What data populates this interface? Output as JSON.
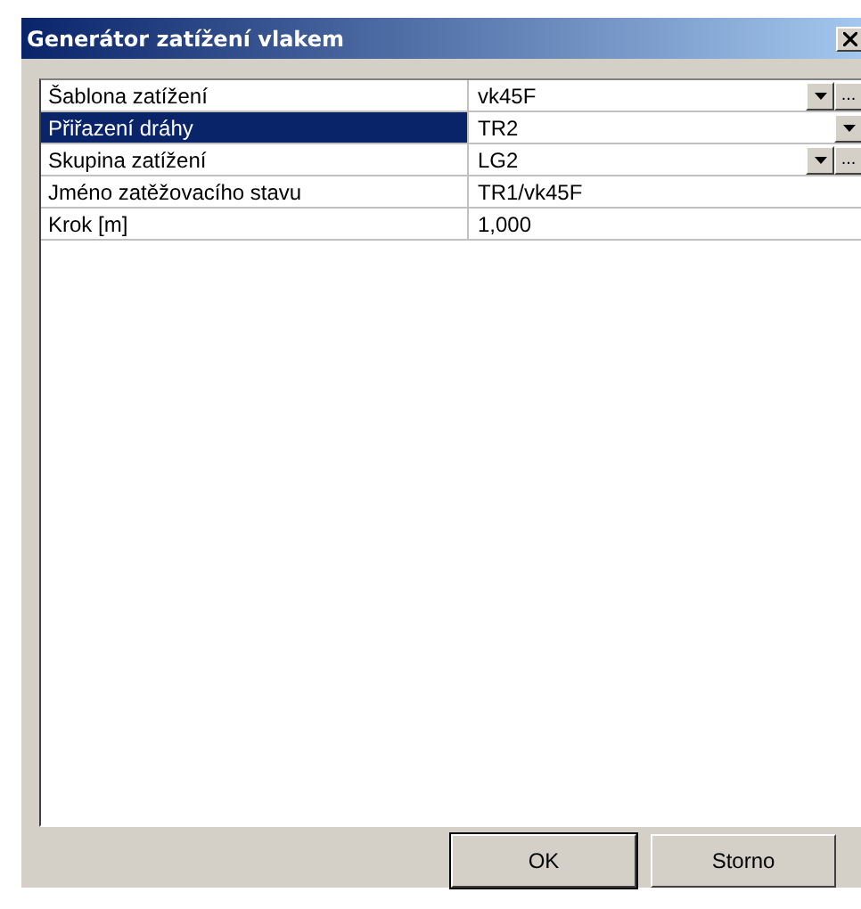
{
  "window": {
    "title": "Generátor zatížení vlakem"
  },
  "rows": [
    {
      "label": "Šablona zatížení",
      "value": "vk45F",
      "kind": "combo_browse",
      "browse_label": "...",
      "selected": false
    },
    {
      "label": "Přiřazení dráhy",
      "value": "TR2",
      "kind": "combo",
      "selected": true
    },
    {
      "label": "Skupina zatížení",
      "value": "LG2",
      "kind": "combo_browse",
      "browse_label": "...",
      "selected": false
    },
    {
      "label": "Jméno zatěžovacího stavu",
      "value": "TR1/vk45F",
      "kind": "text",
      "selected": false
    },
    {
      "label": "Krok [m]",
      "value": "1,000",
      "kind": "text",
      "selected": false
    }
  ],
  "buttons": [
    {
      "label": "OK",
      "default": true
    },
    {
      "label": "Storno",
      "default": false
    }
  ]
}
